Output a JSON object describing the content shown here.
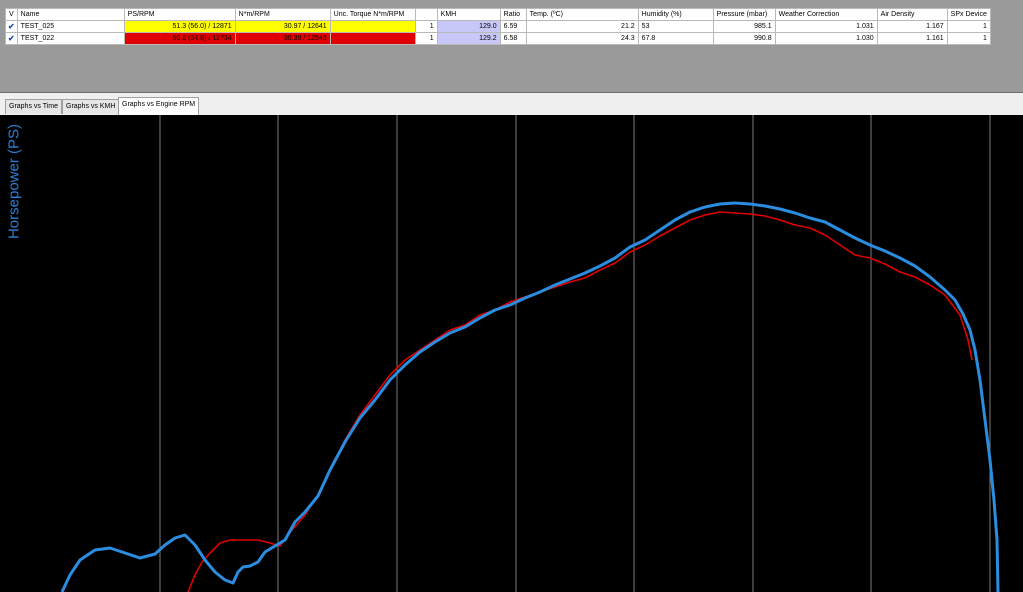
{
  "table": {
    "headers": [
      "V",
      "Name",
      "PS/RPM",
      "N*m/RPM",
      "Unc. Torque N*m/RPM",
      "",
      "KMH",
      "Ratio",
      "Temp. (ºC)",
      "Humidity (%)",
      "Pressure (mbar)",
      "Weather Correction",
      "Air Density",
      "SPx Device"
    ],
    "rows": [
      {
        "checked": true,
        "name": "TEST_025",
        "ps_rpm": "51.3 (56.0) / 12871",
        "nm_rpm": "30.97 / 12641",
        "unc_torque": "",
        "col_blank": "1",
        "kmh": "129.0",
        "ratio": "6.59",
        "temp": "21.2",
        "humidity": "53",
        "pressure": "985.1",
        "weather_correction": "1.031",
        "air_density": "1.167",
        "spx_device": "1",
        "color": "#ffff00"
      },
      {
        "checked": true,
        "name": "TEST_022",
        "ps_rpm": "50.2 (54.8) / 12734",
        "nm_rpm": "30.39 / 12545",
        "unc_torque": "",
        "col_blank": "1",
        "kmh": "129.2",
        "ratio": "6.58",
        "temp": "24.3",
        "humidity": "67.8",
        "pressure": "990.8",
        "weather_correction": "1.030",
        "air_density": "1.161",
        "spx_device": "1",
        "color": "#e00000"
      }
    ]
  },
  "tabs": [
    {
      "label": "Graphs vs Time",
      "active": false
    },
    {
      "label": "Graphs vs KMH",
      "active": false
    },
    {
      "label": "Graphs vs Engine RPM",
      "active": true
    }
  ],
  "chart_data": {
    "type": "line",
    "ylabel": "Horsepower (PS)",
    "grid": "vertical lines only",
    "background": "#000000",
    "series": [
      {
        "color": "#e00000",
        "points": [
          [
            188,
            592
          ],
          [
            195,
            575
          ],
          [
            202,
            562
          ],
          [
            210,
            553
          ],
          [
            220,
            543
          ],
          [
            230,
            540
          ],
          [
            245,
            540
          ],
          [
            258,
            540
          ],
          [
            270,
            543
          ],
          [
            280,
            546
          ],
          [
            292,
            530
          ],
          [
            305,
            515
          ],
          [
            318,
            495
          ],
          [
            330,
            470
          ],
          [
            345,
            440
          ],
          [
            360,
            415
          ],
          [
            375,
            395
          ],
          [
            390,
            375
          ],
          [
            405,
            360
          ],
          [
            420,
            350
          ],
          [
            435,
            340
          ],
          [
            450,
            330
          ],
          [
            465,
            325
          ],
          [
            480,
            315
          ],
          [
            495,
            310
          ],
          [
            510,
            302
          ],
          [
            525,
            297
          ],
          [
            540,
            292
          ],
          [
            555,
            287
          ],
          [
            570,
            282
          ],
          [
            585,
            278
          ],
          [
            600,
            270
          ],
          [
            615,
            263
          ],
          [
            630,
            252
          ],
          [
            645,
            245
          ],
          [
            660,
            236
          ],
          [
            675,
            228
          ],
          [
            690,
            220
          ],
          [
            705,
            215
          ],
          [
            720,
            212
          ],
          [
            735,
            213
          ],
          [
            750,
            214
          ],
          [
            765,
            216
          ],
          [
            780,
            220
          ],
          [
            795,
            225
          ],
          [
            810,
            228
          ],
          [
            825,
            235
          ],
          [
            840,
            245
          ],
          [
            855,
            255
          ],
          [
            870,
            258
          ],
          [
            885,
            264
          ],
          [
            900,
            272
          ],
          [
            915,
            277
          ],
          [
            930,
            285
          ],
          [
            945,
            295
          ],
          [
            960,
            315
          ],
          [
            968,
            340
          ],
          [
            972,
            360
          ]
        ]
      },
      {
        "color": "#2b8de0",
        "points": [
          [
            62,
            592
          ],
          [
            70,
            575
          ],
          [
            80,
            560
          ],
          [
            95,
            550
          ],
          [
            110,
            548
          ],
          [
            125,
            553
          ],
          [
            140,
            558
          ],
          [
            155,
            554
          ],
          [
            165,
            545
          ],
          [
            175,
            538
          ],
          [
            185,
            535
          ],
          [
            195,
            545
          ],
          [
            205,
            560
          ],
          [
            215,
            572
          ],
          [
            225,
            580
          ],
          [
            233,
            583
          ],
          [
            238,
            572
          ],
          [
            243,
            567
          ],
          [
            250,
            566
          ],
          [
            258,
            562
          ],
          [
            265,
            552
          ],
          [
            275,
            546
          ],
          [
            285,
            540
          ],
          [
            295,
            522
          ],
          [
            305,
            512
          ],
          [
            318,
            496
          ],
          [
            330,
            470
          ],
          [
            345,
            442
          ],
          [
            360,
            418
          ],
          [
            375,
            400
          ],
          [
            390,
            380
          ],
          [
            405,
            365
          ],
          [
            420,
            352
          ],
          [
            435,
            342
          ],
          [
            450,
            333
          ],
          [
            465,
            327
          ],
          [
            480,
            318
          ],
          [
            495,
            310
          ],
          [
            510,
            305
          ],
          [
            525,
            298
          ],
          [
            540,
            292
          ],
          [
            555,
            285
          ],
          [
            570,
            279
          ],
          [
            585,
            273
          ],
          [
            600,
            266
          ],
          [
            615,
            258
          ],
          [
            630,
            247
          ],
          [
            645,
            240
          ],
          [
            660,
            230
          ],
          [
            675,
            220
          ],
          [
            690,
            212
          ],
          [
            705,
            207
          ],
          [
            720,
            204
          ],
          [
            735,
            203
          ],
          [
            750,
            204
          ],
          [
            765,
            206
          ],
          [
            780,
            209
          ],
          [
            795,
            213
          ],
          [
            810,
            218
          ],
          [
            825,
            222
          ],
          [
            840,
            230
          ],
          [
            855,
            238
          ],
          [
            870,
            245
          ],
          [
            885,
            251
          ],
          [
            900,
            258
          ],
          [
            915,
            266
          ],
          [
            930,
            277
          ],
          [
            945,
            290
          ],
          [
            955,
            300
          ],
          [
            963,
            314
          ],
          [
            970,
            330
          ],
          [
            975,
            350
          ],
          [
            980,
            380
          ],
          [
            985,
            420
          ],
          [
            990,
            460
          ],
          [
            994,
            500
          ],
          [
            997,
            540
          ],
          [
            998,
            592
          ]
        ]
      }
    ],
    "gridlines_x": [
      160,
      278,
      397,
      516,
      634,
      753,
      871,
      990
    ]
  }
}
